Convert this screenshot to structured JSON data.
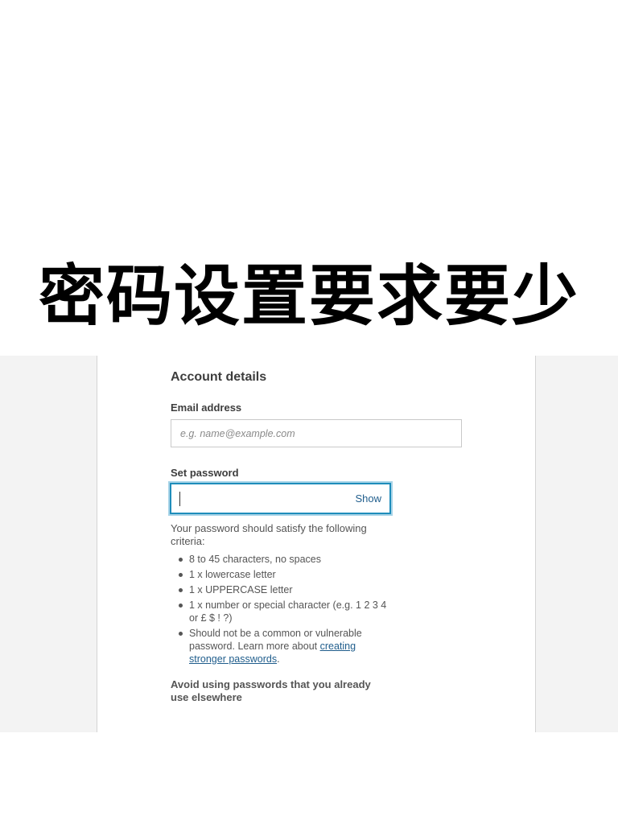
{
  "caption": "密码设置要求要少",
  "form": {
    "heading": "Account details",
    "email_label": "Email address",
    "email_placeholder": "e.g. name@example.com",
    "email_value": "",
    "password_label": "Set password",
    "password_value": "",
    "show_label": "Show",
    "criteria_intro": "Your password should satisfy the following criteria:",
    "criteria": [
      {
        "text": "8 to 45 characters, no spaces"
      },
      {
        "text": "1 x lowercase letter"
      },
      {
        "text": "1 x UPPERCASE letter"
      },
      {
        "text": "1 x number or special character (e.g. 1 2 3 4 or £ $ ! ?)"
      },
      {
        "text": "Should not be a common or vulnerable password. Learn more about ",
        "link_text": "creating stronger passwords",
        "suffix": "."
      }
    ],
    "avoid_note": "Avoid using passwords that you already use elsewhere"
  },
  "colors": {
    "accent": "#1f8dbb",
    "link": "#1f5d8c",
    "page_background": "#f3f3f3"
  }
}
